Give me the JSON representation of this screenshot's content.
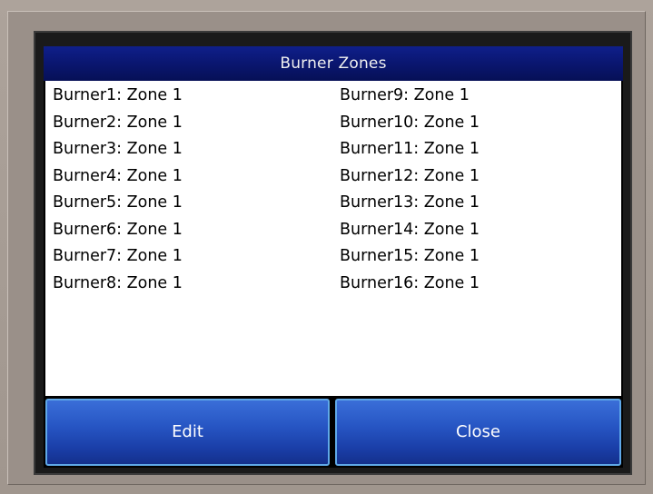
{
  "dialog": {
    "title": "Burner Zones"
  },
  "burners": {
    "left": [
      "Burner1: Zone 1",
      "Burner2: Zone 1",
      "Burner3: Zone 1",
      "Burner4: Zone 1",
      "Burner5: Zone 1",
      "Burner6: Zone 1",
      "Burner7: Zone 1",
      "Burner8: Zone 1"
    ],
    "right": [
      "Burner9: Zone 1",
      "Burner10: Zone 1",
      "Burner11: Zone 1",
      "Burner12: Zone 1",
      "Burner13: Zone 1",
      "Burner14: Zone 1",
      "Burner15: Zone 1",
      "Burner16: Zone 1"
    ]
  },
  "buttons": {
    "edit_label": "Edit",
    "close_label": "Close"
  },
  "colors": {
    "title_bar": "#0a1670",
    "button_blue": "#2756c4",
    "button_border": "#5fa8e8",
    "bezel": "#a49a92"
  }
}
